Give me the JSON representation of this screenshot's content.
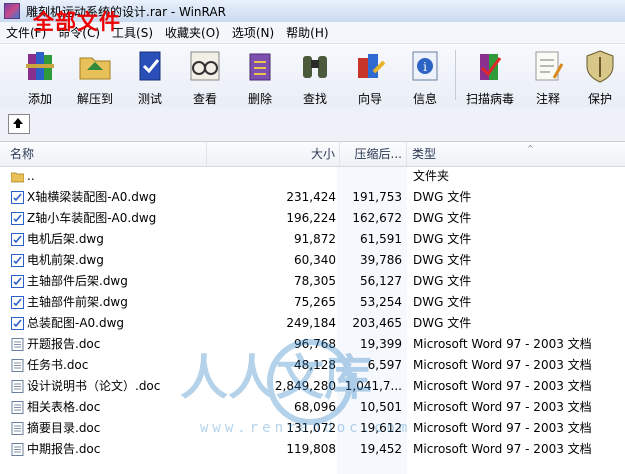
{
  "window": {
    "title": "雕刻机运动系统的设计.rar - WinRAR"
  },
  "overlay_text": "全部文件",
  "menu": [
    {
      "label": "文件(F)"
    },
    {
      "label": "命令(C)"
    },
    {
      "label": "工具(S)"
    },
    {
      "label": "收藏夹(O)"
    },
    {
      "label": "选项(N)"
    },
    {
      "label": "帮助(H)"
    }
  ],
  "toolbar": [
    {
      "label": "添加",
      "icon": "add-books-icon"
    },
    {
      "label": "解压到",
      "icon": "extract-folder-icon"
    },
    {
      "label": "测试",
      "icon": "test-book-icon"
    },
    {
      "label": "查看",
      "icon": "view-glasses-icon"
    },
    {
      "label": "删除",
      "icon": "delete-recycle-icon"
    },
    {
      "label": "查找",
      "icon": "find-binoculars-icon"
    },
    {
      "label": "向导",
      "icon": "wizard-icon"
    },
    {
      "label": "信息",
      "icon": "info-icon"
    },
    {
      "label": "扫描病毒",
      "icon": "virus-scan-icon"
    },
    {
      "label": "注释",
      "icon": "comment-icon"
    },
    {
      "label": "保护",
      "icon": "protect-shield-icon"
    }
  ],
  "columns": {
    "name": "名称",
    "size": "大小",
    "packed": "压缩后...",
    "type": "类型"
  },
  "files": [
    {
      "name": "..",
      "size": "",
      "packed": "",
      "type": "文件夹",
      "icon": "folder"
    },
    {
      "name": "X轴横梁装配图-A0.dwg",
      "size": "231,424",
      "packed": "191,753",
      "type": "DWG 文件",
      "icon": "dwg"
    },
    {
      "name": "Z轴小车装配图-A0.dwg",
      "size": "196,224",
      "packed": "162,672",
      "type": "DWG 文件",
      "icon": "dwg"
    },
    {
      "name": "电机后架.dwg",
      "size": "91,872",
      "packed": "61,591",
      "type": "DWG 文件",
      "icon": "dwg"
    },
    {
      "name": "电机前架.dwg",
      "size": "60,340",
      "packed": "39,786",
      "type": "DWG 文件",
      "icon": "dwg"
    },
    {
      "name": "主轴部件后架.dwg",
      "size": "78,305",
      "packed": "56,127",
      "type": "DWG 文件",
      "icon": "dwg"
    },
    {
      "name": "主轴部件前架.dwg",
      "size": "75,265",
      "packed": "53,254",
      "type": "DWG 文件",
      "icon": "dwg"
    },
    {
      "name": "总装配图-A0.dwg",
      "size": "249,184",
      "packed": "203,465",
      "type": "DWG 文件",
      "icon": "dwg"
    },
    {
      "name": "开题报告.doc",
      "size": "96,768",
      "packed": "19,399",
      "type": "Microsoft Word 97 - 2003 文档",
      "icon": "doc"
    },
    {
      "name": "任务书.doc",
      "size": "48,128",
      "packed": "6,597",
      "type": "Microsoft Word 97 - 2003 文档",
      "icon": "doc"
    },
    {
      "name": "设计说明书（论文）.doc",
      "size": "2,849,280",
      "packed": "1,041,7...",
      "type": "Microsoft Word 97 - 2003 文档",
      "icon": "doc"
    },
    {
      "name": "相关表格.doc",
      "size": "68,096",
      "packed": "10,501",
      "type": "Microsoft Word 97 - 2003 文档",
      "icon": "doc"
    },
    {
      "name": "摘要目录.doc",
      "size": "131,072",
      "packed": "19,612",
      "type": "Microsoft Word 97 - 2003 文档",
      "icon": "doc"
    },
    {
      "name": "中期报告.doc",
      "size": "119,808",
      "packed": "19,452",
      "type": "Microsoft Word 97 - 2003 文档",
      "icon": "doc"
    }
  ],
  "watermark": {
    "text": "人人文库",
    "url": "www.renrendoc.com"
  }
}
